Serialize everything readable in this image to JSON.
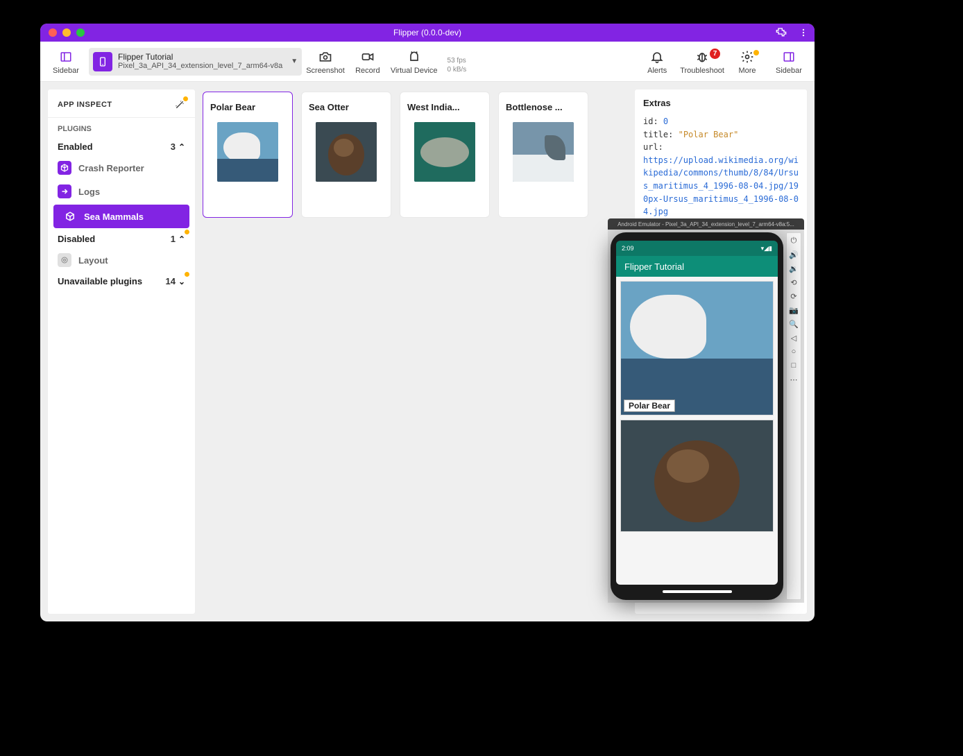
{
  "titlebar": {
    "title": "Flipper (0.0.0-dev)"
  },
  "toolbar": {
    "sidebar_label": "Sidebar",
    "device": {
      "app_name": "Flipper Tutorial",
      "device_name": "Pixel_3a_API_34_extension_level_7_arm64-v8a"
    },
    "screenshot_label": "Screenshot",
    "record_label": "Record",
    "virtual_label": "Virtual Device",
    "fps": "53 fps",
    "kbs": "0 kB/s",
    "alerts_label": "Alerts",
    "troubleshoot_label": "Troubleshoot",
    "troubleshoot_badge": "7",
    "more_label": "More",
    "sidebar_right_label": "Sidebar"
  },
  "sidebar": {
    "inspect_label": "APP INSPECT",
    "plugins_label": "PLUGINS",
    "enabled_label": "Enabled",
    "enabled_count": "3",
    "items": [
      {
        "label": "Crash Reporter"
      },
      {
        "label": "Logs"
      },
      {
        "label": "Sea Mammals"
      }
    ],
    "disabled_label": "Disabled",
    "disabled_count": "1",
    "disabled_items": [
      {
        "label": "Layout"
      }
    ],
    "unavailable_label": "Unavailable plugins",
    "unavailable_count": "14"
  },
  "cards": [
    {
      "title": "Polar Bear"
    },
    {
      "title": "Sea Otter"
    },
    {
      "title": "West India..."
    },
    {
      "title": "Bottlenose ..."
    }
  ],
  "extras": {
    "heading": "Extras",
    "id_key": "id:",
    "id_val": "0",
    "title_key": "title:",
    "title_val": "\"Polar Bear\"",
    "url_key": "url:",
    "url_val": "https://upload.wikimedia.org/wikipedia/commons/thumb/8/84/Ursus_maritimus_4_1996-08-04.jpg/190px-Ursus_maritimus_4_1996-08-04.jpg"
  },
  "emulator": {
    "title": "Android Emulator - Pixel_3a_API_34_extension_level_7_arm64-v8a:5...",
    "status_time": "2:09",
    "app_title": "Flipper Tutorial",
    "card1_label": "Polar Bear"
  }
}
